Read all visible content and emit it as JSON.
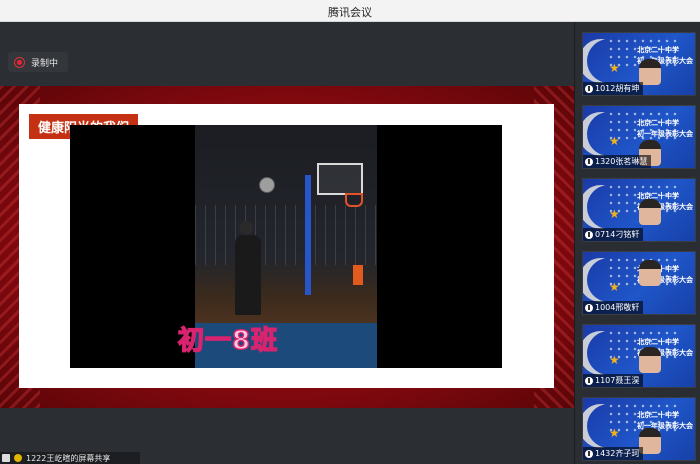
{
  "app": {
    "title": "腾讯会议"
  },
  "recording": {
    "label": "录制中"
  },
  "shared_screen": {
    "slide_title": "健康阳光的我们",
    "video_caption": "初一8班"
  },
  "bottom_bar": {
    "text": "1222王屹暄的屏幕共享"
  },
  "participant_banner": {
    "line1": "北京二十中学",
    "line2": "初一年级表彰大会"
  },
  "participants": [
    {
      "name": "1012胡有坤"
    },
    {
      "name": "1320张茗琳慧"
    },
    {
      "name": "0714刁铭轩"
    },
    {
      "name": "1004邢敬轩"
    },
    {
      "name": "1107聂王淏"
    },
    {
      "name": "1432齐子珂"
    }
  ],
  "colors": {
    "accent_red": "#c53113",
    "tile_blue": "#1f56c9",
    "caption_pink": "#ffc6e0"
  }
}
